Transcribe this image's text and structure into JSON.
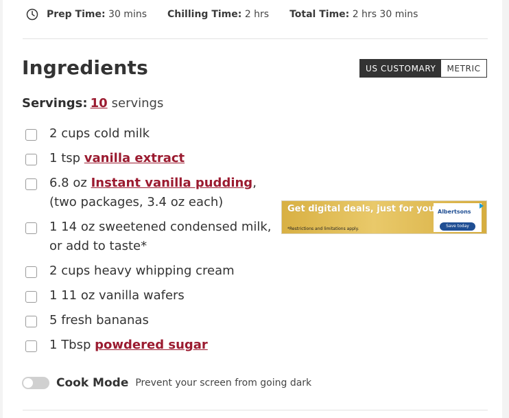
{
  "times": [
    {
      "label": "Prep Time:",
      "value": "30 mins"
    },
    {
      "label": "Chilling Time:",
      "value": "2 hrs"
    },
    {
      "label": "Total Time:",
      "value": "2 hrs 30 mins"
    }
  ],
  "ingredients": {
    "title": "Ingredients",
    "units": {
      "us": "US CUSTOMARY",
      "metric": "METRIC",
      "active": "us"
    },
    "servings": {
      "label": "Servings:",
      "value": "10",
      "unit": "servings"
    },
    "items": [
      {
        "amount": "2",
        "unit": "cups",
        "name": "cold milk",
        "link": false,
        "note": ""
      },
      {
        "amount": "1",
        "unit": "tsp",
        "name": "vanilla extract",
        "link": true,
        "note": ""
      },
      {
        "amount": "6.8",
        "unit": "oz",
        "name": "Instant vanilla pudding",
        "link": true,
        "note": ", (two packages, 3.4 oz each)"
      },
      {
        "amount": "1 14",
        "unit": "oz",
        "name": "sweetened condensed milk, or add to taste*",
        "link": false,
        "note": ""
      },
      {
        "amount": "2",
        "unit": "cups",
        "name": "heavy whipping cream",
        "link": false,
        "note": ""
      },
      {
        "amount": "1 11",
        "unit": "oz",
        "name": "vanilla wafers",
        "link": false,
        "note": ""
      },
      {
        "amount": "5",
        "unit": "",
        "name": "fresh bananas",
        "link": false,
        "note": ""
      },
      {
        "amount": "1",
        "unit": "Tbsp",
        "name": "powdered sugar",
        "link": true,
        "note": ""
      }
    ]
  },
  "ad": {
    "headline": "Get digital deals, just for you.",
    "fine_print": "*Restrictions and limitations apply.",
    "brand": "Albertsons",
    "button": "Save today"
  },
  "cook_mode": {
    "label": "Cook Mode",
    "description": "Prevent your screen from going dark",
    "enabled": false
  },
  "colors": {
    "link": "#9b1b30",
    "unit_active": "#333333",
    "text": "#333333"
  }
}
